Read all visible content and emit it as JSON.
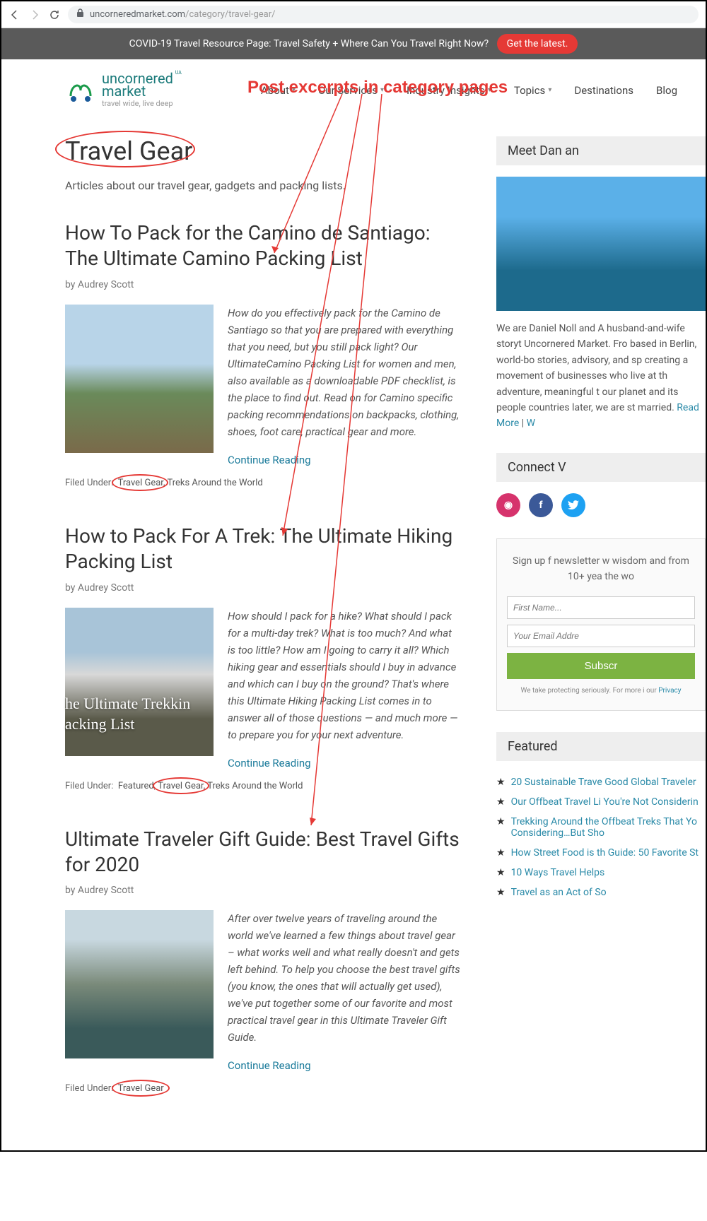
{
  "browser": {
    "url_host": "uncorneredmarket.com",
    "url_path": "/category/travel-gear/"
  },
  "covid": {
    "text": "COVID-19 Travel Resource Page: Travel Safety + Where Can You Travel Right Now?",
    "button": "Get the latest."
  },
  "logo": {
    "line1": "uncornered",
    "line2": "market",
    "tagline": "travel wide, live deep",
    "tm": "UA"
  },
  "nav": {
    "items": [
      "About",
      "Our Services",
      "Industry Insights",
      "Topics",
      "Destinations",
      "Blog"
    ]
  },
  "annotation": {
    "header": "Post excerpts in category pages"
  },
  "category": {
    "title": "Travel Gear",
    "desc": "Articles about our travel gear, gadgets and packing lists."
  },
  "posts": [
    {
      "title": "How To Pack for the Camino de Santiago: The Ultimate Camino Packing List",
      "by": "by Audrey Scott",
      "excerpt": "How do you effectively pack for the Camino de Santiago so that you are prepared with everything that you need, but you still pack light? Our UltimateCamino Packing List for women and men, also available as a downloadable PDF checklist, is the place to find out. Read on for Camino specific packing recommendations on backpacks, clothing, shoes, foot care, practical gear and more.",
      "continue": "Continue Reading",
      "filed_label": "Filed Under:",
      "filed_tags": [
        "Travel Gear",
        "Treks Around the World"
      ]
    },
    {
      "title": "How to Pack For A Trek: The Ultimate Hiking Packing List",
      "by": "by Audrey Scott",
      "excerpt": "How should I pack for a hike? What should I pack for a multi-day trek? What is too much? And what is too little? How am I going to carry it all? Which hiking gear and essentials should I buy in advance and which can I buy on the ground? That's where this Ultimate Hiking Packing List comes in to answer all of those questions — and much more — to prepare you for your next adventure.",
      "continue": "Continue Reading",
      "filed_label": "Filed Under:",
      "filed_tags": [
        "Featured",
        "Travel Gear",
        "Treks Around the World"
      ],
      "img_overlay": "he Ultimate Trekkin\nacking List"
    },
    {
      "title": "Ultimate Traveler Gift Guide: Best Travel Gifts for 2020",
      "by": "by Audrey Scott",
      "excerpt": "After over twelve years of traveling around the world we've learned a few things about travel gear – what works well and what really doesn't and gets left behind. To help you choose the best travel gifts (you know, the ones that will actually get used), we've put together some of our favorite and most practical travel gear in this Ultimate Traveler Gift Guide.",
      "continue": "Continue Reading",
      "filed_label": "Filed Under:",
      "filed_tags": [
        "Travel Gear"
      ]
    }
  ],
  "sidebar": {
    "meet_heading": "Meet Dan an",
    "bio": "We are Daniel Noll and A husband-and-wife storyt Uncornered Market. Fro based in Berlin, world-bo stories, advisory, and sp creating a movement of businesses who live at th adventure, meaningful t our planet and its people countries later, we are st married. ",
    "read_more": "Read More",
    "sep": " | ",
    "work": "W",
    "connect_heading": "Connect V",
    "signup_text": "Sign up f newsletter w wisdom and from 10+ yea the wo",
    "first_placeholder": "First Name...",
    "email_placeholder": "Your Email Addre",
    "subscribe": "Subscr",
    "privacy": "We take protecting seriously. For more i our ",
    "privacy_link": "Privacy",
    "featured_heading": "Featured",
    "featured": [
      "20 Sustainable Trave Good Global Traveler",
      "Our Offbeat Travel Li You're Not Considerin",
      "Trekking Around the Offbeat Treks That Yo Considering…But Sho",
      "How Street Food is th Guide: 50 Favorite St",
      "10 Ways Travel Helps",
      "Travel as an Act of So"
    ]
  }
}
